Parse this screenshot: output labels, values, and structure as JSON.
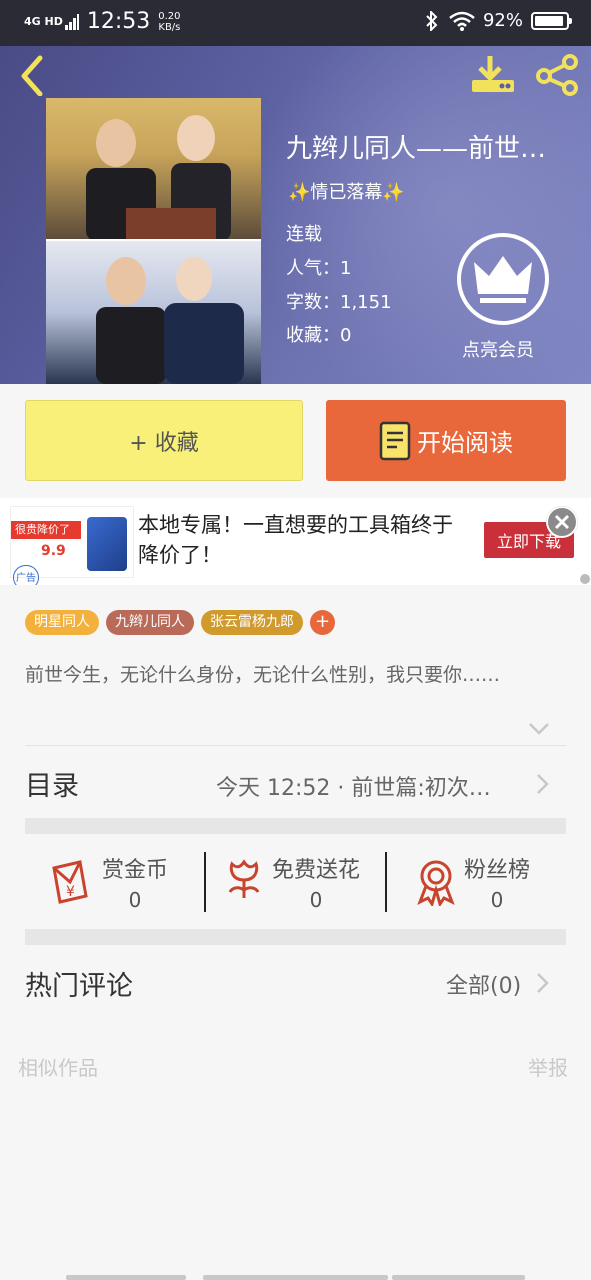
{
  "status_bar": {
    "network": "4G HD",
    "time": "12:53",
    "speed_value": "0.20",
    "speed_unit": "KB/s",
    "battery": "92%",
    "battery_level": 0.92
  },
  "book": {
    "title": "九辫儿同人——前世…",
    "tagline": "情已落幕",
    "tagline_star": "✨",
    "status": "连载",
    "popularity": "人气：1",
    "word_count": "字数：1,151",
    "favorites": "收藏：0",
    "vip_label": "点亮会员"
  },
  "actions": {
    "favorite_label": "+ 收藏",
    "read_label": "开始阅读"
  },
  "ad": {
    "headline": "本地专属！一直想要的工具箱终于降价了！",
    "cta": "立即下载",
    "image_title": "很贵降价了",
    "image_price": "9.9",
    "image_tag": "广告"
  },
  "tags": [
    {
      "label": "明星同人",
      "color": "#f2b13c"
    },
    {
      "label": "九辫儿同人",
      "color": "#b96a58"
    },
    {
      "label": "张云雷杨九郎",
      "color": "#d19a2c"
    }
  ],
  "tag_add": "+",
  "description": "前世今生，无论什么身份，无论什么性别，我只要你……",
  "toc": {
    "label": "目录",
    "latest": "今天 12:52 · 前世篇:初次…"
  },
  "stats": [
    {
      "label": "赏金币",
      "value": "0"
    },
    {
      "label": "免费送花",
      "value": "0"
    },
    {
      "label": "粉丝榜",
      "value": "0"
    }
  ],
  "comments": {
    "label": "热门评论",
    "all": "全部(0)"
  },
  "footer": {
    "similar": "相似作品",
    "report": "举报"
  },
  "colors": {
    "accent_orange": "#e8673b",
    "favorite_yellow": "#f9f07a",
    "icon_red": "#c9442c",
    "download_yellow": "#f2e15a"
  }
}
